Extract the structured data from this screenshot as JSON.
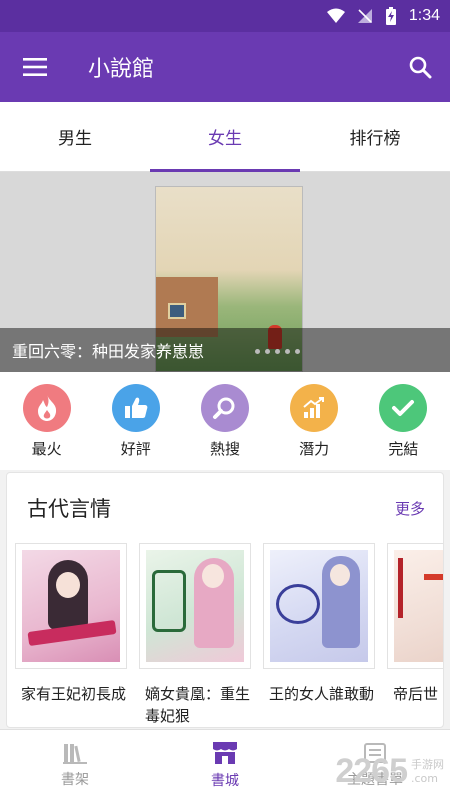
{
  "status": {
    "time": "1:34"
  },
  "app": {
    "title": "小說館"
  },
  "tabs": [
    {
      "label": "男生"
    },
    {
      "label": "女生"
    },
    {
      "label": "排行榜"
    }
  ],
  "banner": {
    "caption": "重回六零：种田发家养崽崽"
  },
  "quick": [
    {
      "label": "最火",
      "icon": "flame-icon",
      "color": "#f07b80"
    },
    {
      "label": "好評",
      "icon": "thumbs-up-icon",
      "color": "#4aa3e8"
    },
    {
      "label": "熱搜",
      "icon": "search-icon",
      "color": "#a98bd1"
    },
    {
      "label": "潛力",
      "icon": "bar-chart-icon",
      "color": "#f3b24a"
    },
    {
      "label": "完結",
      "icon": "check-icon",
      "color": "#4dc77a"
    }
  ],
  "section": {
    "title": "古代言情",
    "more": "更多",
    "books": [
      {
        "title": "家有王妃初長成"
      },
      {
        "title": "嫡女貴凰：重生毒妃狠"
      },
      {
        "title": "王的女人誰敢動"
      },
      {
        "title": "帝后世"
      }
    ]
  },
  "nav": [
    {
      "label": "書架",
      "icon": "bookshelf-icon"
    },
    {
      "label": "書城",
      "icon": "store-icon"
    },
    {
      "label": "主題書單",
      "icon": "list-icon"
    }
  ]
}
